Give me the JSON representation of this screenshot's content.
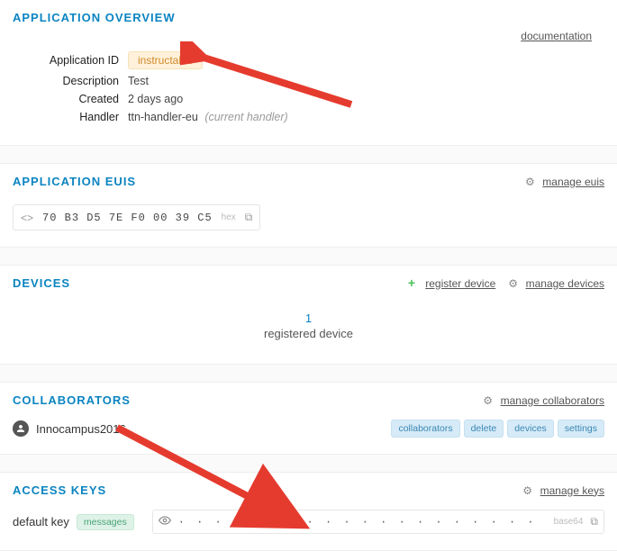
{
  "documentation_link": "documentation",
  "overview": {
    "title": "APPLICATION OVERVIEW",
    "fields": {
      "app_id_label": "Application ID",
      "app_id_value": "instructable",
      "description_label": "Description",
      "description_value": "Test",
      "created_label": "Created",
      "created_value": "2 days ago",
      "handler_label": "Handler",
      "handler_value": "ttn-handler-eu",
      "handler_note": "(current handler)"
    }
  },
  "euis": {
    "title": "APPLICATION EUIS",
    "manage_label": "manage euis",
    "value": "70 B3 D5 7E F0 00 39 C5",
    "format_tag": "hex"
  },
  "devices": {
    "title": "DEVICES",
    "register_label": "register device",
    "manage_label": "manage devices",
    "count": "1",
    "count_label": "registered device"
  },
  "collaborators": {
    "title": "COLLABORATORS",
    "manage_label": "manage collaborators",
    "user": "Innocampus2016",
    "pills": {
      "a": "collaborators",
      "b": "delete",
      "c": "devices",
      "d": "settings"
    }
  },
  "access_keys": {
    "title": "ACCESS KEYS",
    "manage_label": "manage keys",
    "key_name": "default key",
    "scope_pill": "messages",
    "masked": "· · · · · · · · · · · · · · · · · · · · · · · · · · · · · · · · · · · · · · · · · · · · · · · · · · · · ·",
    "format_tag": "base64"
  }
}
